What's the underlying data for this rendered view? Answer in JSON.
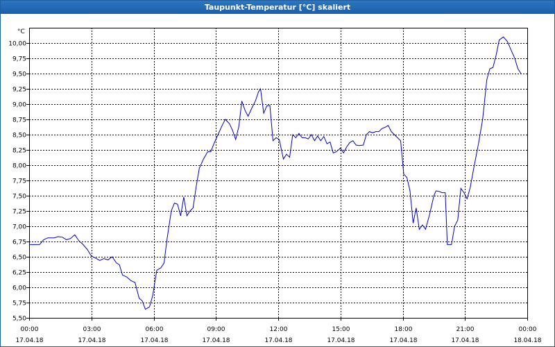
{
  "window": {
    "title": "Taupunkt-Temperatur [°C] skaliert"
  },
  "colors": {
    "series": "#0000c0",
    "grid": "#000000",
    "titlebar": "#1f64ad"
  },
  "chart_data": {
    "type": "line",
    "title": "Taupunkt-Temperatur [°C] skaliert",
    "ylabel": "°C",
    "xlabel": "",
    "grid": true,
    "ylim": [
      5.5,
      10.25
    ],
    "xlim": [
      0,
      24
    ],
    "y_ticks": [
      5.5,
      5.75,
      6.0,
      6.25,
      6.5,
      6.75,
      7.0,
      7.25,
      7.5,
      7.75,
      8.0,
      8.25,
      8.5,
      8.75,
      9.0,
      9.25,
      9.5,
      9.75,
      10.0
    ],
    "y_tick_labels": [
      "5,50",
      "5,75",
      "6,00",
      "6,25",
      "6,50",
      "6,75",
      "7,00",
      "7,25",
      "7,50",
      "7,75",
      "8,00",
      "8,25",
      "8,50",
      "8,75",
      "9,00",
      "9,25",
      "9,50",
      "9,75",
      "10,00"
    ],
    "x_ticks": [
      {
        "hour": 0,
        "time": "00:00",
        "date": "17.04.18"
      },
      {
        "hour": 3,
        "time": "03:00",
        "date": "17.04.18"
      },
      {
        "hour": 6,
        "time": "06:00",
        "date": "17.04.18"
      },
      {
        "hour": 9,
        "time": "09:00",
        "date": "17.04.18"
      },
      {
        "hour": 12,
        "time": "12:00",
        "date": "17.04.18"
      },
      {
        "hour": 15,
        "time": "15:00",
        "date": "17.04.18"
      },
      {
        "hour": 18,
        "time": "18:00",
        "date": "17.04.18"
      },
      {
        "hour": 21,
        "time": "21:00",
        "date": "17.04.18"
      },
      {
        "hour": 24,
        "time": "00:00",
        "date": "18.04.18"
      }
    ],
    "series": [
      {
        "points": [
          [
            0.0,
            6.7
          ],
          [
            0.5,
            6.7
          ],
          [
            0.7,
            6.78
          ],
          [
            0.9,
            6.81
          ],
          [
            1.2,
            6.81
          ],
          [
            1.4,
            6.83
          ],
          [
            1.6,
            6.82
          ],
          [
            1.8,
            6.78
          ],
          [
            2.0,
            6.8
          ],
          [
            2.2,
            6.86
          ],
          [
            2.4,
            6.76
          ],
          [
            2.6,
            6.7
          ],
          [
            2.8,
            6.62
          ],
          [
            3.0,
            6.51
          ],
          [
            3.2,
            6.48
          ],
          [
            3.4,
            6.44
          ],
          [
            3.6,
            6.47
          ],
          [
            3.8,
            6.45
          ],
          [
            4.0,
            6.5
          ],
          [
            4.2,
            6.4
          ],
          [
            4.35,
            6.37
          ],
          [
            4.5,
            6.2
          ],
          [
            4.7,
            6.17
          ],
          [
            4.9,
            6.11
          ],
          [
            5.1,
            6.08
          ],
          [
            5.3,
            5.82
          ],
          [
            5.45,
            5.78
          ],
          [
            5.6,
            5.64
          ],
          [
            5.8,
            5.68
          ],
          [
            5.95,
            5.86
          ],
          [
            6.15,
            6.28
          ],
          [
            6.35,
            6.32
          ],
          [
            6.5,
            6.4
          ],
          [
            6.65,
            6.8
          ],
          [
            6.85,
            7.25
          ],
          [
            7.0,
            7.38
          ],
          [
            7.15,
            7.36
          ],
          [
            7.3,
            7.17
          ],
          [
            7.45,
            7.48
          ],
          [
            7.6,
            7.17
          ],
          [
            7.75,
            7.25
          ],
          [
            7.9,
            7.3
          ],
          [
            8.05,
            7.65
          ],
          [
            8.2,
            7.95
          ],
          [
            8.4,
            8.1
          ],
          [
            8.6,
            8.22
          ],
          [
            8.75,
            8.22
          ],
          [
            8.9,
            8.35
          ],
          [
            9.1,
            8.5
          ],
          [
            9.3,
            8.65
          ],
          [
            9.45,
            8.75
          ],
          [
            9.65,
            8.68
          ],
          [
            9.8,
            8.57
          ],
          [
            9.95,
            8.42
          ],
          [
            10.1,
            8.63
          ],
          [
            10.25,
            9.05
          ],
          [
            10.4,
            8.9
          ],
          [
            10.55,
            8.8
          ],
          [
            10.75,
            8.95
          ],
          [
            10.9,
            9.05
          ],
          [
            11.05,
            9.2
          ],
          [
            11.15,
            9.25
          ],
          [
            11.3,
            8.85
          ],
          [
            11.45,
            8.97
          ],
          [
            11.6,
            8.98
          ],
          [
            11.75,
            8.4
          ],
          [
            11.9,
            8.45
          ],
          [
            12.05,
            8.42
          ],
          [
            12.25,
            8.1
          ],
          [
            12.4,
            8.18
          ],
          [
            12.55,
            8.13
          ],
          [
            12.7,
            8.5
          ],
          [
            12.85,
            8.45
          ],
          [
            13.0,
            8.52
          ],
          [
            13.15,
            8.45
          ],
          [
            13.3,
            8.45
          ],
          [
            13.45,
            8.43
          ],
          [
            13.6,
            8.5
          ],
          [
            13.75,
            8.4
          ],
          [
            13.9,
            8.48
          ],
          [
            14.05,
            8.4
          ],
          [
            14.2,
            8.47
          ],
          [
            14.35,
            8.35
          ],
          [
            14.5,
            8.38
          ],
          [
            14.65,
            8.2
          ],
          [
            14.8,
            8.22
          ],
          [
            15.0,
            8.28
          ],
          [
            15.15,
            8.2
          ],
          [
            15.3,
            8.3
          ],
          [
            15.45,
            8.37
          ],
          [
            15.6,
            8.4
          ],
          [
            15.75,
            8.33
          ],
          [
            15.9,
            8.32
          ],
          [
            16.1,
            8.33
          ],
          [
            16.25,
            8.5
          ],
          [
            16.4,
            8.55
          ],
          [
            16.55,
            8.53
          ],
          [
            16.7,
            8.55
          ],
          [
            16.85,
            8.55
          ],
          [
            17.0,
            8.6
          ],
          [
            17.15,
            8.62
          ],
          [
            17.3,
            8.65
          ],
          [
            17.45,
            8.55
          ],
          [
            17.6,
            8.5
          ],
          [
            17.75,
            8.45
          ],
          [
            17.9,
            8.4
          ],
          [
            18.05,
            7.85
          ],
          [
            18.2,
            7.8
          ],
          [
            18.35,
            7.58
          ],
          [
            18.5,
            7.05
          ],
          [
            18.65,
            7.3
          ],
          [
            18.8,
            6.95
          ],
          [
            18.95,
            7.02
          ],
          [
            19.1,
            6.95
          ],
          [
            19.3,
            7.2
          ],
          [
            19.5,
            7.5
          ],
          [
            19.6,
            7.58
          ],
          [
            19.75,
            7.57
          ],
          [
            19.9,
            7.55
          ],
          [
            20.05,
            7.55
          ],
          [
            20.15,
            6.7
          ],
          [
            20.35,
            6.7
          ],
          [
            20.5,
            7.0
          ],
          [
            20.65,
            7.1
          ],
          [
            20.8,
            7.62
          ],
          [
            20.95,
            7.55
          ],
          [
            21.1,
            7.45
          ],
          [
            21.25,
            7.63
          ],
          [
            21.45,
            8.0
          ],
          [
            21.65,
            8.35
          ],
          [
            21.85,
            8.75
          ],
          [
            22.05,
            9.4
          ],
          [
            22.2,
            9.58
          ],
          [
            22.35,
            9.6
          ],
          [
            22.5,
            9.8
          ],
          [
            22.65,
            10.05
          ],
          [
            22.85,
            10.1
          ],
          [
            23.05,
            10.02
          ],
          [
            23.2,
            9.9
          ],
          [
            23.4,
            9.75
          ],
          [
            23.55,
            9.58
          ],
          [
            23.7,
            9.5
          ]
        ]
      }
    ]
  }
}
